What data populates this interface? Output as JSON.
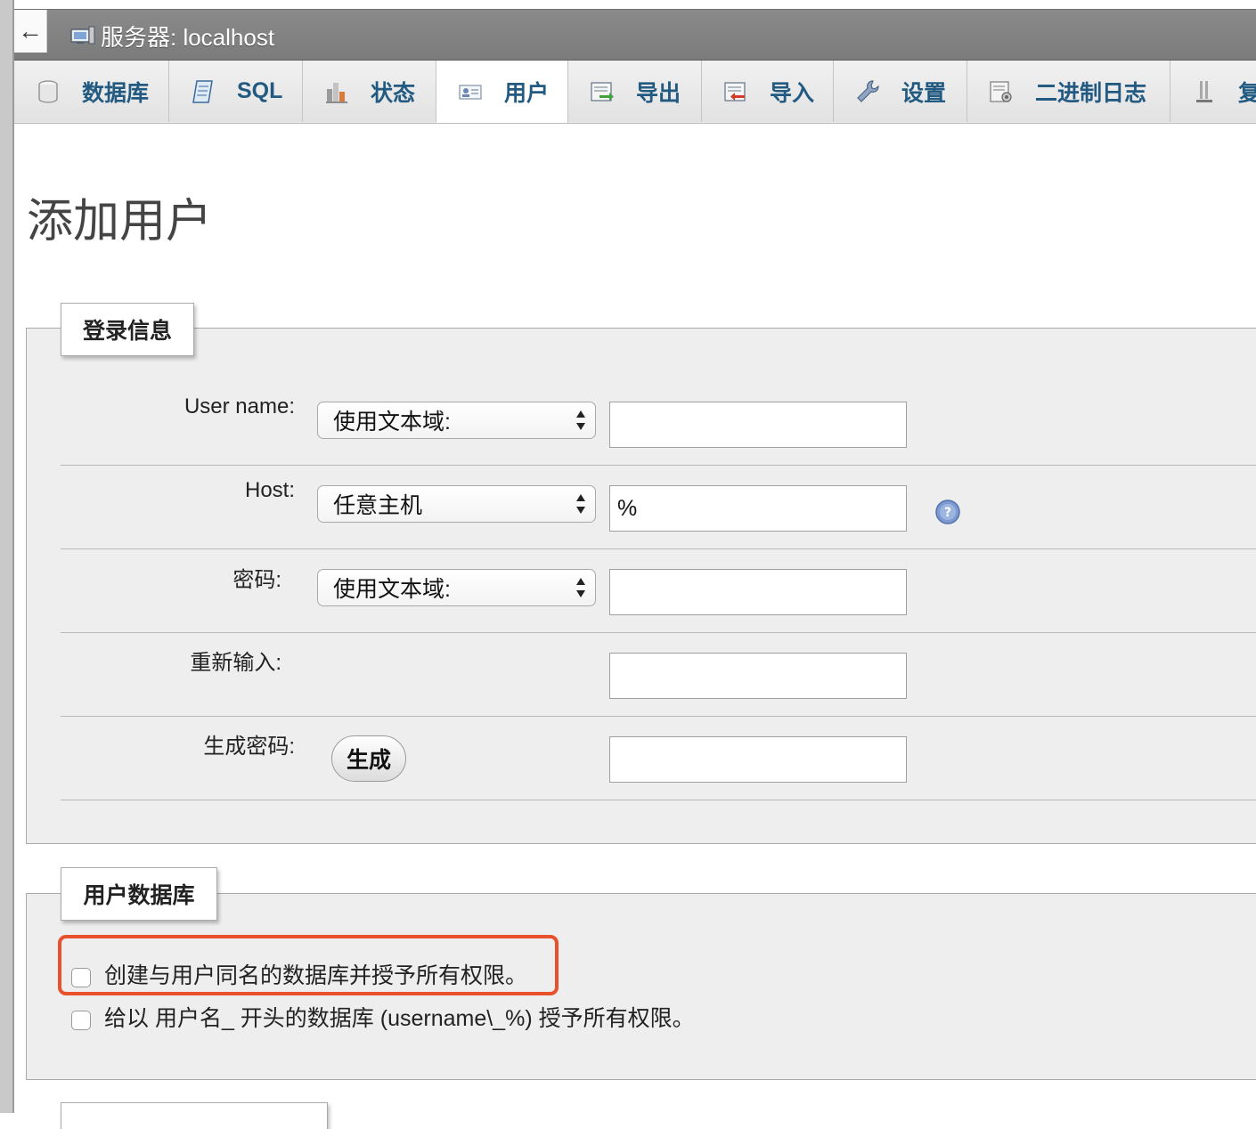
{
  "window": {
    "back_glyph": "←",
    "server_title": "服务器: localhost"
  },
  "tabs": [
    {
      "label": "数据库",
      "icon": "database-icon"
    },
    {
      "label": "SQL",
      "icon": "sql-scroll-icon"
    },
    {
      "label": "状态",
      "icon": "status-chart-icon"
    },
    {
      "label": "用户",
      "icon": "users-card-icon",
      "active": true
    },
    {
      "label": "导出",
      "icon": "export-icon"
    },
    {
      "label": "导入",
      "icon": "import-icon"
    },
    {
      "label": "设置",
      "icon": "wrench-icon"
    },
    {
      "label": "二进制日志",
      "icon": "binlog-icon"
    },
    {
      "label": "复",
      "icon": "replication-icon"
    }
  ],
  "page": {
    "title": "添加用户"
  },
  "login_info": {
    "legend": "登录信息",
    "username_label": "User name:",
    "username_select": "使用文本域:",
    "username_value": "",
    "host_label": "Host:",
    "host_select": "任意主机",
    "host_value": "%",
    "password_label": "密码:",
    "password_select": "使用文本域:",
    "password_value": "",
    "reenter_label": "重新输入:",
    "reenter_value": "",
    "generate_label": "生成密码:",
    "generate_button": "生成",
    "generated_value": ""
  },
  "user_database": {
    "legend": "用户数据库",
    "option1": "创建与用户同名的数据库并授予所有权限。",
    "option2": "给以 用户名_ 开头的数据库 (username\\_%) 授予所有权限。"
  },
  "colors": {
    "tab_text": "#235a81",
    "highlight": "#e8512d",
    "topbar": "#808080"
  }
}
